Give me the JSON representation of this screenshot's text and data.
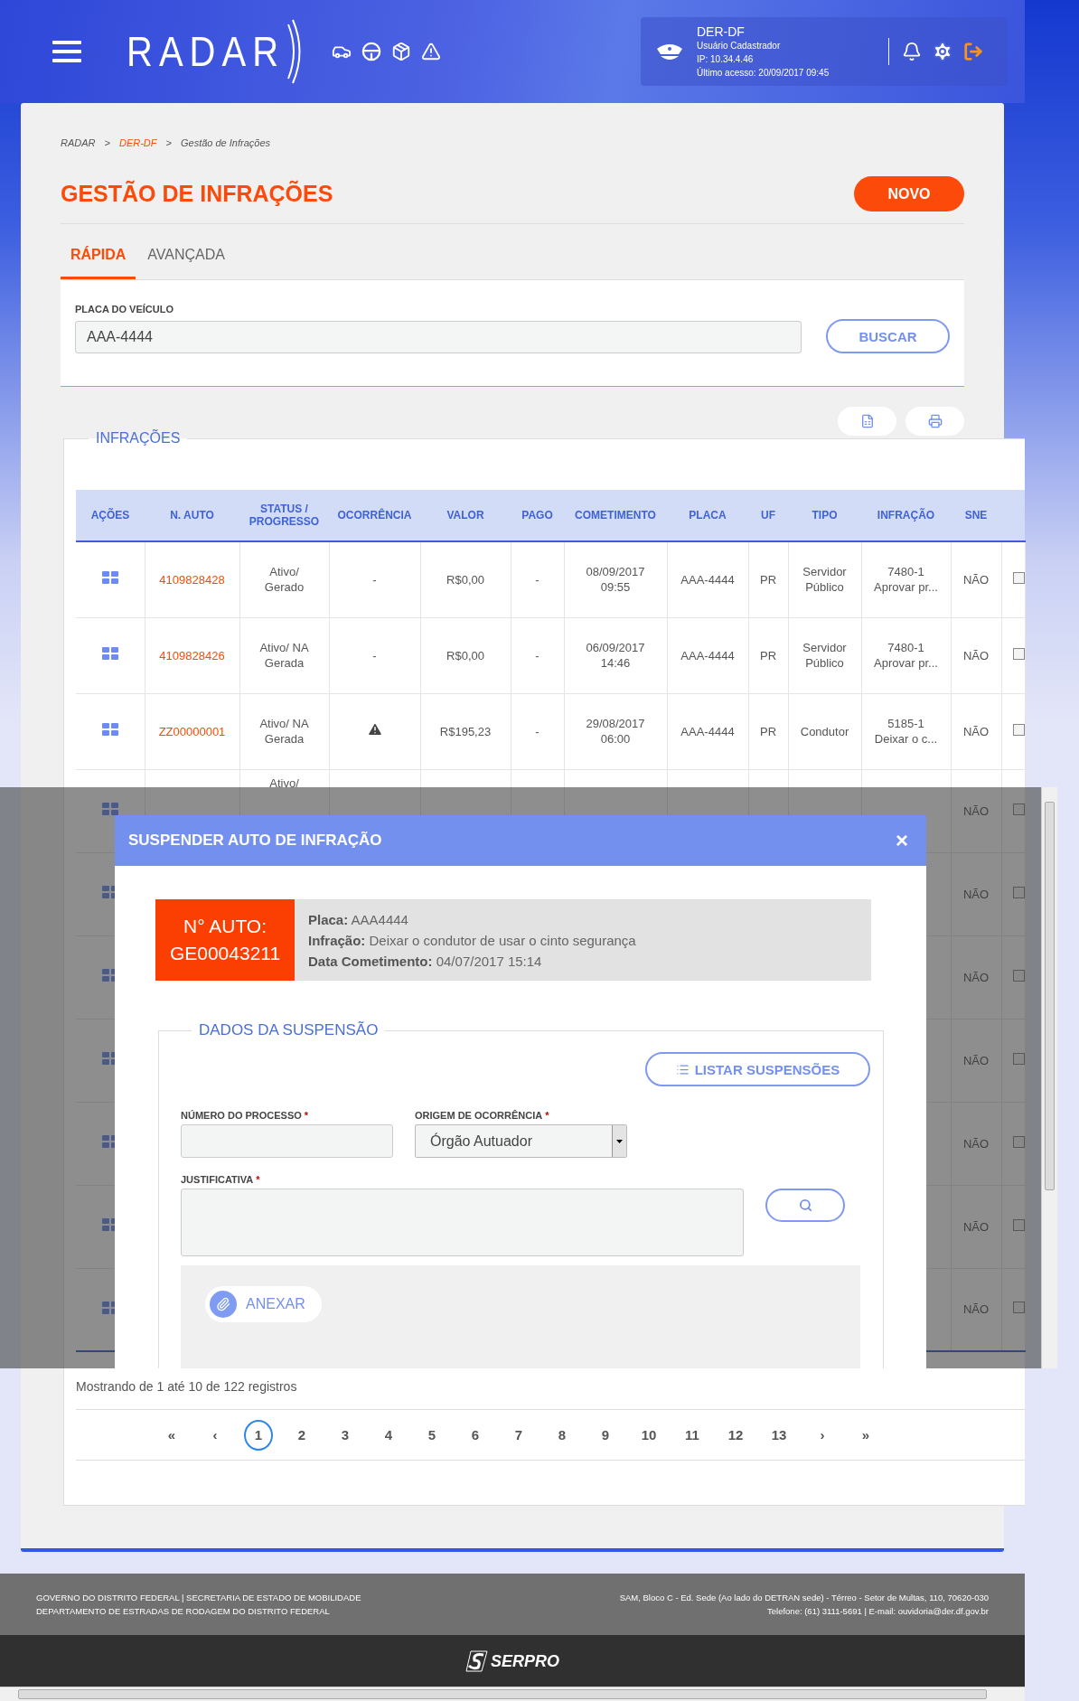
{
  "header": {
    "logo": "RADAR",
    "user": {
      "org": "DER-DF",
      "role": "Usuário Cadastrador",
      "ip": "IP: 10.34.4.46",
      "last_access": "Último acesso: 20/09/2017 09:45"
    }
  },
  "breadcrumb": [
    {
      "label": "RADAR",
      "kind": "text"
    },
    {
      "label": "DER-DF",
      "kind": "link"
    },
    {
      "label": "Gestão de Infrações",
      "kind": "text"
    }
  ],
  "breadcrumb_separator": ">",
  "page_title": "GESTÃO DE INFRAÇÕES",
  "new_button": "NOVO",
  "tabs": [
    {
      "label": "RÁPIDA",
      "selected": true
    },
    {
      "label": "AVANÇADA",
      "selected": false
    }
  ],
  "search": {
    "label": "PLACA DO VEÍCULO",
    "value": "AAA-4444",
    "button": "BUSCAR"
  },
  "results": {
    "legend": "INFRAÇÕES",
    "columns": [
      "AÇÕES",
      "N. AUTO",
      "STATUS / PROGRESSO",
      "OCORRÊNCIA",
      "VALOR",
      "PAGO",
      "COMETIMENTO",
      "PLACA",
      "UF",
      "TIPO",
      "INFRAÇÃO",
      "SNE"
    ],
    "rows": [
      {
        "auto": "4109828428",
        "status": "Ativo/ Gerado",
        "ocorrencia": {
          "kind": "text",
          "text": "-"
        },
        "valor": "R$0,00",
        "pago": "-",
        "cometimento": "08/09/2017 09:55",
        "placa": "AAA-4444",
        "uf": "PR",
        "tipo": "Servidor Público",
        "infracao": "7480-1 Aprovar pr...",
        "sne": "NÃO",
        "checked": false
      },
      {
        "auto": "4109828426",
        "status": "Ativo/ NA Gerada",
        "ocorrencia": {
          "kind": "text",
          "text": "-"
        },
        "valor": "R$0,00",
        "pago": "-",
        "cometimento": "06/09/2017 14:46",
        "placa": "AAA-4444",
        "uf": "PR",
        "tipo": "Servidor Público",
        "infracao": "7480-1 Aprovar pr...",
        "sne": "NÃO",
        "checked": false
      },
      {
        "auto": "ZZ00000001",
        "status": "Ativo/ NA Gerada",
        "ocorrencia": {
          "kind": "alert"
        },
        "valor": "R$195,23",
        "pago": "-",
        "cometimento": "29/08/2017 06:00",
        "placa": "AAA-4444",
        "uf": "PR",
        "tipo": "Condutor",
        "infracao": "5185-1 Deixar o c...",
        "sne": "NÃO",
        "checked": false
      },
      {
        "status": "Ativo/",
        "sne": "NÃO",
        "checked": false
      },
      {
        "sne": "NÃO",
        "checked": false
      },
      {
        "sne": "NÃO",
        "checked": false
      },
      {
        "sne": "NÃO",
        "checked": false
      },
      {
        "sne": "NÃO",
        "checked": false
      },
      {
        "sne": "NÃO",
        "checked": false
      },
      {
        "sne": "NÃO",
        "checked": false
      }
    ],
    "summary": "Mostrando de 1 até 10 de 122 registros",
    "pagination": {
      "first": "«",
      "prev": "‹",
      "next": "›",
      "last": "»",
      "pages": [
        {
          "label": "1",
          "selected": true
        },
        {
          "label": "2",
          "selected": false
        },
        {
          "label": "3",
          "selected": false
        },
        {
          "label": "4",
          "selected": false
        },
        {
          "label": "5",
          "selected": false
        },
        {
          "label": "6",
          "selected": false
        },
        {
          "label": "7",
          "selected": false
        },
        {
          "label": "8",
          "selected": false
        },
        {
          "label": "9",
          "selected": false
        },
        {
          "label": "10",
          "selected": false
        },
        {
          "label": "11",
          "selected": false
        },
        {
          "label": "12",
          "selected": false
        },
        {
          "label": "13",
          "selected": false
        }
      ]
    }
  },
  "modal": {
    "title": "SUSPENDER AUTO DE INFRAÇÃO",
    "close": "×",
    "auto_label": "N° AUTO:",
    "auto_number": "GE00043211",
    "details": [
      {
        "label": "Placa:",
        "value": "AAA4444"
      },
      {
        "label": "Infração:",
        "value": "Deixar o condutor de usar o cinto segurança"
      },
      {
        "label": "Data Cometimento:",
        "value": "04/07/2017 15:14"
      }
    ],
    "legend": "DADOS DA SUSPENSÃO",
    "list_button": "LISTAR SUSPENSÕES",
    "process_field": {
      "label": "NÚMERO DO PROCESSO",
      "required_mark": "*"
    },
    "origin_field": {
      "label": "ORIGEM DE OCORRÊNCIA",
      "required_mark": "*",
      "value": "Órgão Autuador"
    },
    "reason_field": {
      "label": "JUSTIFICATIVA",
      "required_mark": "*"
    },
    "attach_button": "ANEXAR"
  },
  "footer": {
    "left": [
      "GOVERNO DO DISTRITO FEDERAL | SECRETARIA DE ESTADO DE MOBILIDADE",
      "DEPARTAMENTO DE ESTRADAS DE RODAGEM DO DISTRITO FEDERAL"
    ],
    "right": [
      "SAM, Bloco C - Ed. Sede (Ao lado do DETRAN sede) - Térreo - Setor de Multas, 110, 70620-030",
      "Telefone: (61) 3111-5691 | E-mail: ouvidoria@der.df.gov.br"
    ],
    "brand": "SERPRO"
  }
}
